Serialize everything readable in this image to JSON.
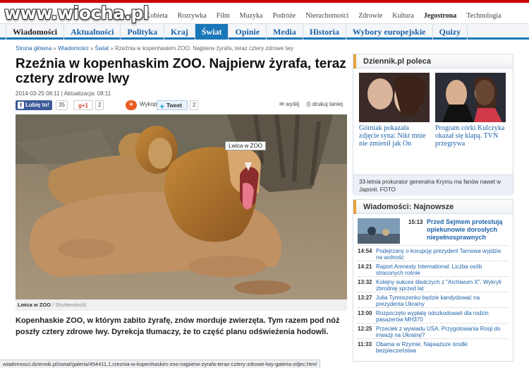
{
  "watermark": "www.wiocha.pl",
  "top_categories": [
    "Auto",
    "Kobieta",
    "Rozrywka",
    "Film",
    "Muzyka",
    "Podróże",
    "Nieruchomości",
    "Zdrowie",
    "Kultura",
    "Jegostrona",
    "Technologia"
  ],
  "nav_tabs": [
    "Wiadomości",
    "Aktualności",
    "Polityka",
    "Kraj",
    "Świat",
    "Opinie",
    "Media",
    "Historia",
    "Wybory europejskie",
    "Quizy"
  ],
  "active_tab": "Świat",
  "breadcrumb": [
    "Strona główna",
    "Wiadomości",
    "Świat",
    "Rzeźnia w kopenhaskim ZOO. Najpierw żyrafa, teraz cztery zdrowe lwy"
  ],
  "article": {
    "title": "Rzeźnia w kopenhaskim ZOO. Najpierw żyrafa, teraz cztery zdrowe lwy",
    "dateline": "2014-03-25 08:11 | Aktualizacja: 08:11",
    "share": {
      "facebook_label": "Lubię to!",
      "facebook_count": "35",
      "gplus_label": "g+1",
      "gplus_count": "2",
      "wykop_label": "Wykop",
      "tweet_label": "Tweet",
      "tweet_count": "2",
      "send_label": "wyślij",
      "print_label": "drukuj taniej"
    },
    "photo_tag": "Lwica w ZOO",
    "caption_title": "Lwica w ZOO",
    "caption_credit": "/ Shutterstock)",
    "lead": "Kopenhaskie ZOO, w którym zabito żyrafę, znów morduje zwierzęta. Tym razem pod nóż poszły cztery zdrowe lwy. Dyrekcja tłumaczy, że to część planu odświeżenia hodowli."
  },
  "sidebar": {
    "recommends_title": "Dziennik.pl poleca",
    "recommends": [
      {
        "text": "Górniak pokazała zdjęcie syna: Nikt mnie nie zmienił jak On"
      },
      {
        "text": "Program córki Kulczyka okazał się klapą. TVN przegrywa"
      }
    ],
    "promo": "33-letnia prokurator generalna Krymu ma fanów nawet w Japonii. FOTO",
    "latest_title": "Wiadomości: Najnowsze",
    "feature": {
      "time": "15:13",
      "text": "Przed Sejmem protestują opiekunowie dorosłych niepełnosprawnych"
    },
    "items": [
      {
        "time": "14:54",
        "text": "Podejrzany o korupcję prezydent Tarnowa wyjdzie na wolność"
      },
      {
        "time": "14:21",
        "text": "Raport Amnesty International: Liczba osób straconych rośnie"
      },
      {
        "time": "13:32",
        "text": "Kolejny sukces śledczych z \"Archiwum X\". Wykryli zbrodnię sprzed lat"
      },
      {
        "time": "13:27",
        "text": "Julia Tymoszenko będzie kandydować na prezydenta Ukrainy"
      },
      {
        "time": "13:00",
        "text": "Rozpoczęto wypłatę odszkodowań dla rodzin pasażerów MH370"
      },
      {
        "time": "12:25",
        "text": "Przeciek z wywiadu USA. Przygotowania Rosji do inwazji na Ukrainę?"
      },
      {
        "time": "11:33",
        "text": "Obama w Rzymie. Najważsze środki bezpieczeństwa"
      }
    ]
  },
  "status_url": "wiadomosci.dziennik.pl/swiat/galeria/454411,1,rzeznia-w-kopenhaskim-zoo-najpierw-zyrafa-teraz-cztery-zdrowe-lwy-galeria-zdjec.html",
  "colors": {
    "accent": "#1a77b8",
    "link": "#1d62a8",
    "brand_red": "#cc0000"
  }
}
